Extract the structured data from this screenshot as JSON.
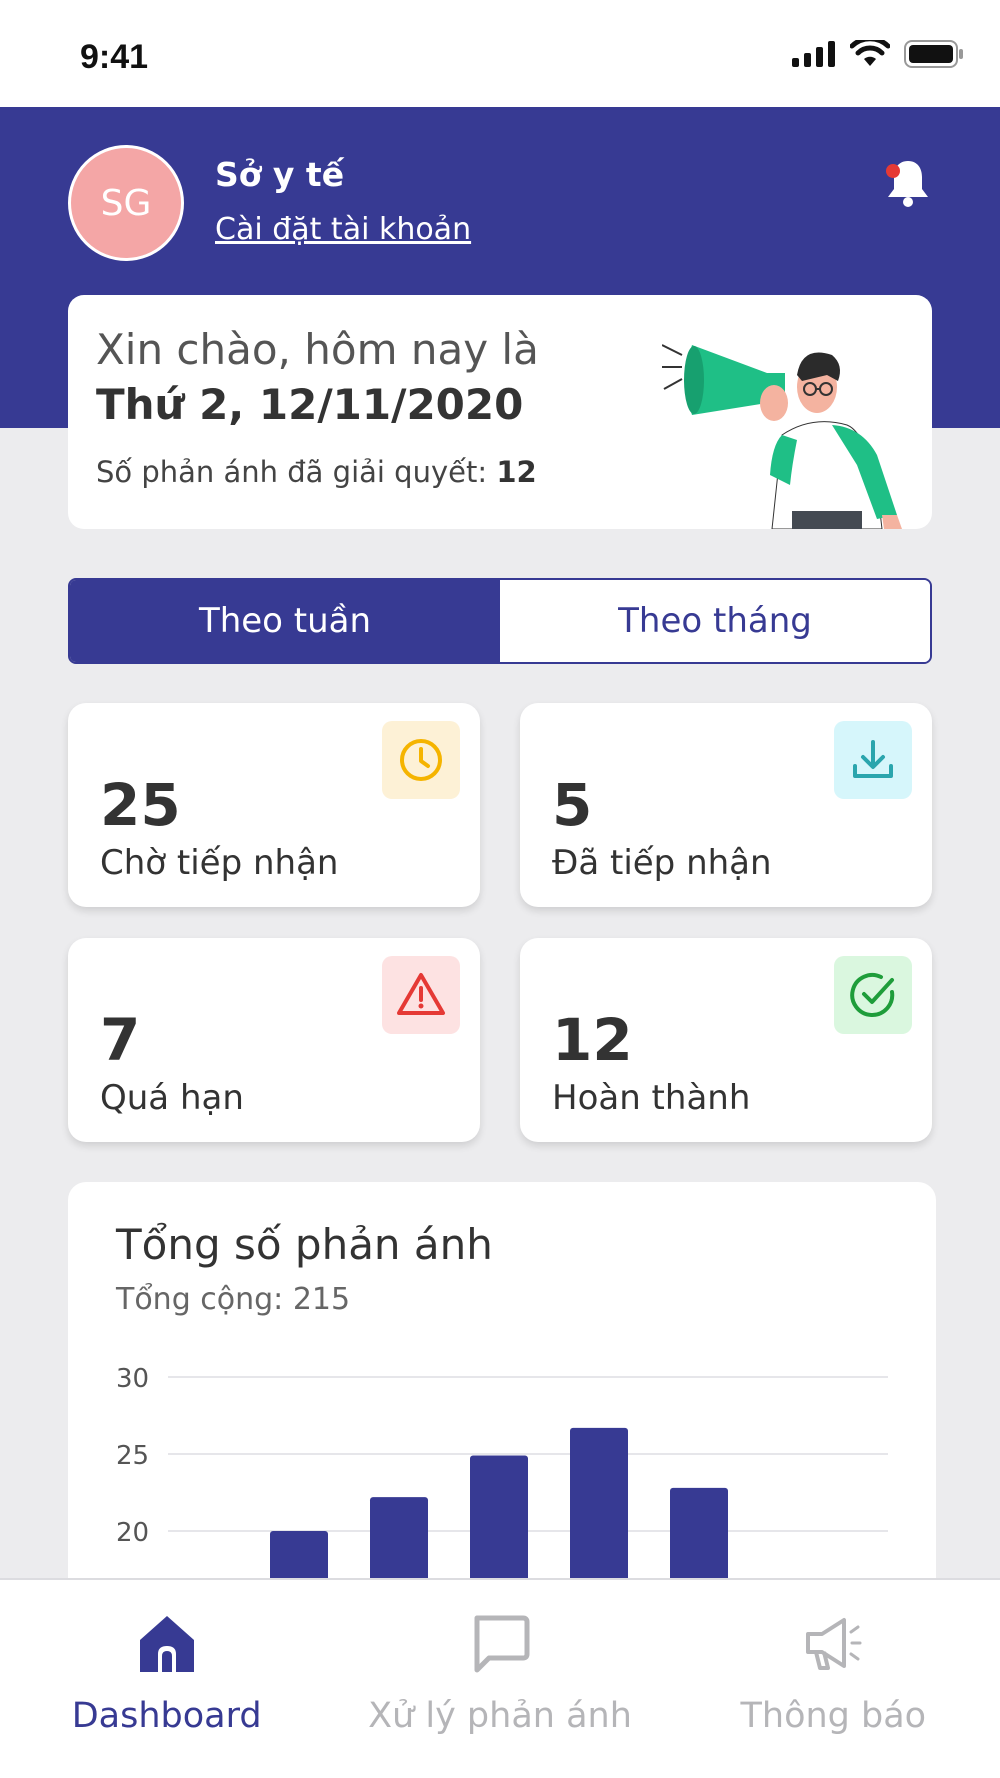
{
  "status_bar": {
    "time": "9:41"
  },
  "header": {
    "avatar_initials": "SG",
    "org_name": "Sở y tế",
    "account_link": "Cài đặt tài khoản",
    "notification_dot": true
  },
  "greeting": {
    "line1": "Xin chào, hôm nay là",
    "line2": "Thứ 2, 12/11/2020",
    "resolved_label": "Số phản ánh đã giải quyết:",
    "resolved_count": "12"
  },
  "period_toggle": {
    "options": [
      "Theo tuần",
      "Theo tháng"
    ],
    "selected": "Theo tuần"
  },
  "stats": [
    {
      "value": "25",
      "label": "Chờ tiếp nhận",
      "icon": "clock-icon",
      "color": "#f5b400",
      "bg": "#fdf1d6"
    },
    {
      "value": "5",
      "label": "Đã tiếp nhận",
      "icon": "download-icon",
      "color": "#2aa5ad",
      "bg": "#d6f6fb"
    },
    {
      "value": "7",
      "label": "Quá hạn",
      "icon": "warning-icon",
      "color": "#e53935",
      "bg": "#fde2e2"
    },
    {
      "value": "12",
      "label": "Hoàn thành",
      "icon": "check-circle-icon",
      "color": "#1e9d3a",
      "bg": "#daf7df"
    }
  ],
  "chart": {
    "title": "Tổng số phản ánh",
    "subtitle": "Tổng cộng: 215"
  },
  "chart_data": {
    "type": "bar",
    "title": "Tổng số phản ánh",
    "subtitle": "Tổng cộng: 215",
    "y_ticks": [
      30,
      25,
      20
    ],
    "ylim": [
      15,
      30
    ],
    "values": [
      20,
      22.2,
      24.9,
      26.7,
      22.8
    ],
    "bar_color": "#373a93",
    "grid": true,
    "note": "lower portion of chart is clipped by the bottom navigation bar"
  },
  "bottom_nav": {
    "items": [
      {
        "label": "Dashboard",
        "icon": "home-icon",
        "active": true
      },
      {
        "label": "Xử lý phản ánh",
        "icon": "chat-icon",
        "active": false
      },
      {
        "label": "Thông báo",
        "icon": "megaphone-icon",
        "active": false
      }
    ]
  },
  "colors": {
    "primary": "#373a93",
    "background": "#ececee",
    "avatar": "#f4a6a6",
    "inactive": "#b5b5b8"
  }
}
